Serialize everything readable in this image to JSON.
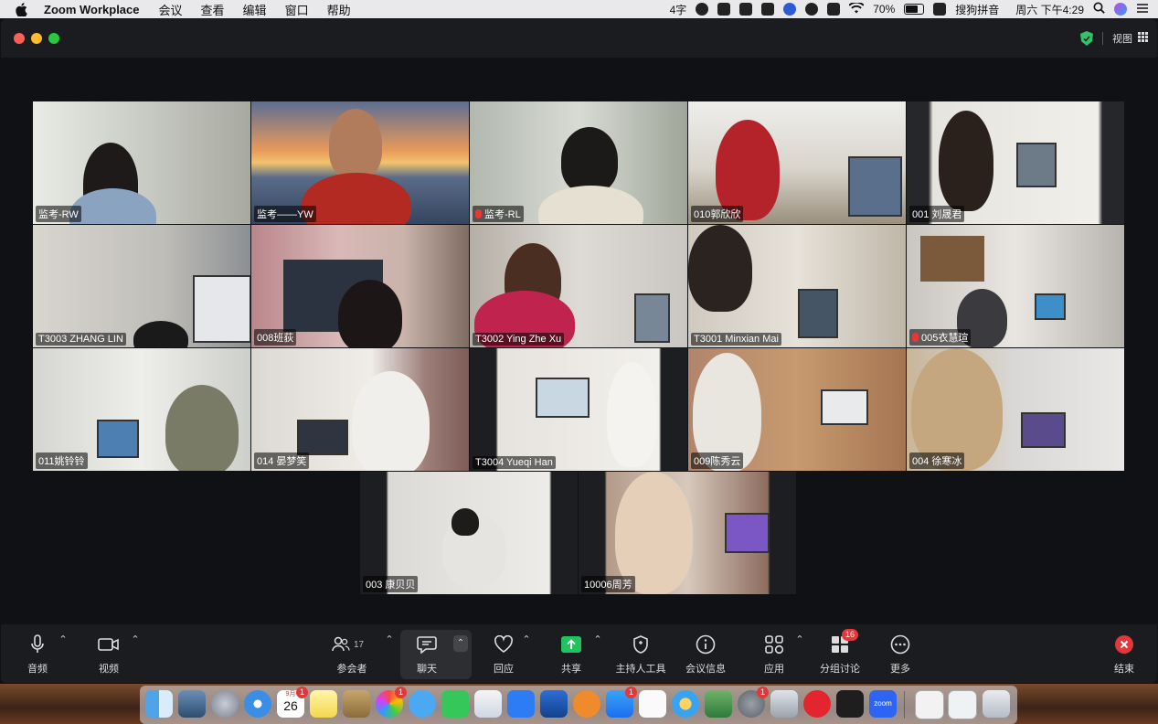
{
  "menubar": {
    "app_name": "Zoom Workplace",
    "items": [
      "会议",
      "查看",
      "编辑",
      "窗口",
      "帮助"
    ],
    "status_char_count": "4字",
    "battery": "70%",
    "input_method": "搜狗拼音",
    "clock": "周六 下午4:29"
  },
  "window": {
    "view_label": "视图"
  },
  "participants": [
    {
      "name": "监考-RW",
      "muted": false,
      "active": true
    },
    {
      "name": "监考——YW",
      "muted": false
    },
    {
      "name": "监考-RL",
      "muted": true
    },
    {
      "name": "010郭欣欣",
      "muted": false
    },
    {
      "name": "001 刘晟君",
      "muted": false
    },
    {
      "name": "T3003 ZHANG LIN",
      "muted": false
    },
    {
      "name": "008班荻",
      "muted": false
    },
    {
      "name": "T3002 Ying Zhe Xu",
      "muted": false
    },
    {
      "name": "T3001 Minxian Mai",
      "muted": false
    },
    {
      "name": "005衣慧瑄",
      "muted": true
    },
    {
      "name": "011姚铃铃",
      "muted": false
    },
    {
      "name": "014 晏梦笑",
      "muted": false
    },
    {
      "name": "T3004 Yueqi Han",
      "muted": false
    },
    {
      "name": "009陈秀云",
      "muted": false
    },
    {
      "name": "004 徐寒冰",
      "muted": false
    },
    {
      "name": "003 康贝贝",
      "muted": false
    },
    {
      "name": "10006周芳",
      "muted": false
    }
  ],
  "toolbar": {
    "audio": "音频",
    "video": "视频",
    "participants": "参会者",
    "participants_count": "17",
    "chat": "聊天",
    "reactions": "回应",
    "share": "共享",
    "host_tools": "主持人工具",
    "meeting_info": "会议信息",
    "apps": "应用",
    "breakout": "分组讨论",
    "breakout_badge": "16",
    "more": "更多",
    "end": "结束"
  },
  "dock": {
    "calendar_month": "9月",
    "calendar_day": "26",
    "badges": {
      "calendar": "1",
      "photos": "1",
      "appstore": "1",
      "settings": "1"
    }
  },
  "colors": {
    "active_speaker_border": "#2fd35a",
    "share_green": "#22c35e",
    "end_red": "#e0383b"
  }
}
